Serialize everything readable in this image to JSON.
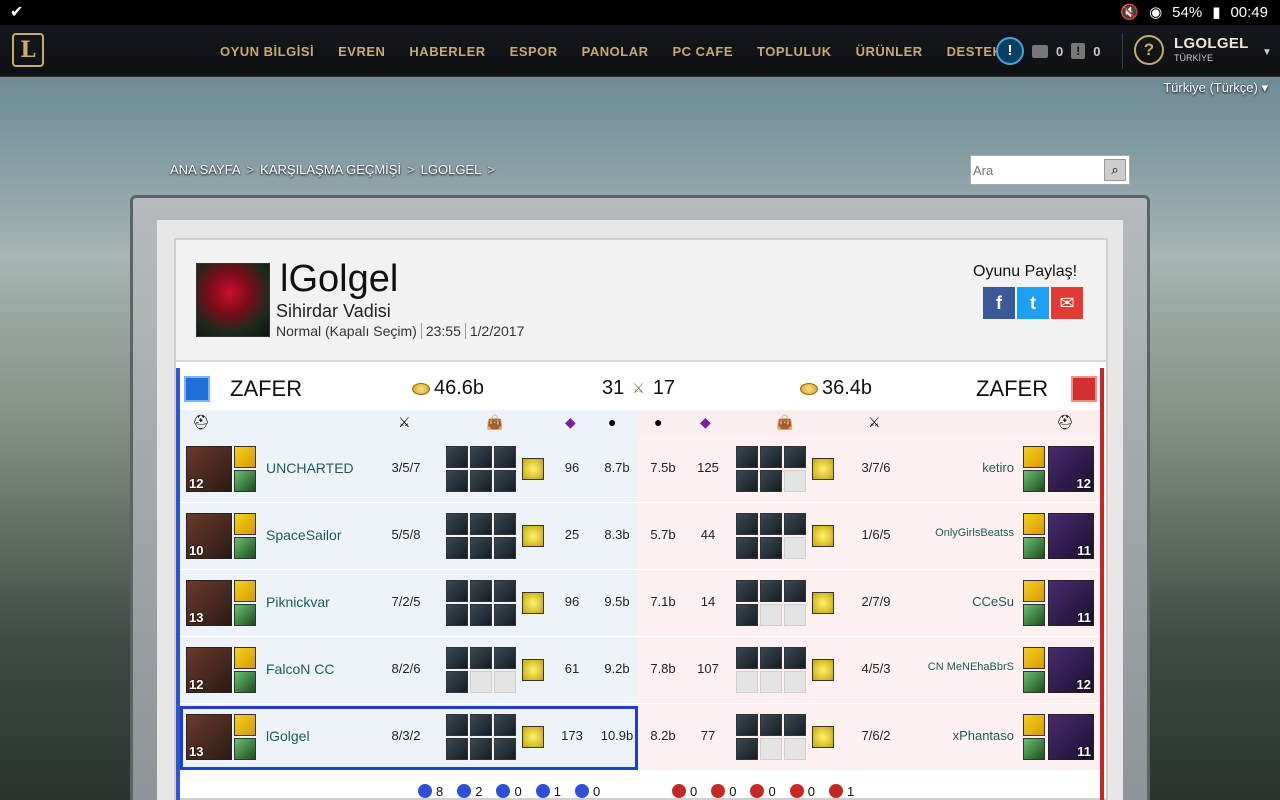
{
  "statusbar": {
    "battery": "54%",
    "time": "00:49"
  },
  "nav": {
    "links": [
      "OYUN BİLGİSİ",
      "EVREN",
      "HABERLER",
      "ESPOR",
      "PANOLAR",
      "PC CAFE",
      "TOPLULUK",
      "ÜRÜNLER",
      "DESTEK"
    ],
    "chat_count": "0",
    "alert_count": "0",
    "username": "LGOLGEL",
    "region": "TÜRKİYE"
  },
  "language": "Türkiye (Türkçe)",
  "breadcrumb": [
    "ANA SAYFA",
    "KARŞILAŞMA GEÇMİŞİ",
    "LGOLGEL"
  ],
  "search": {
    "placeholder": "Ara"
  },
  "game": {
    "summoner": "lGolgel",
    "map": "Sihirdar Vadisi",
    "mode": "Normal (Kapalı Seçim)",
    "duration": "23:55",
    "date": "1/2/2017",
    "share_label": "Oyunu Paylaş!"
  },
  "teams": {
    "blue": {
      "result": "ZAFER",
      "gold": "46.6b",
      "kills": "31"
    },
    "red": {
      "result": "ZAFER",
      "gold": "36.4b",
      "kills": "17"
    }
  },
  "rows": [
    {
      "blue": {
        "level": "12",
        "name": "UNCHARTED",
        "kda": "3/5/7",
        "cs": "96",
        "gold": "8.7b",
        "empty_items": 0
      },
      "red": {
        "level": "12",
        "name": "ketiro",
        "kda": "3/7/6",
        "cs": "125",
        "gold": "7.5b",
        "empty_items": 1
      }
    },
    {
      "blue": {
        "level": "10",
        "name": "SpaceSailor",
        "kda": "5/5/8",
        "cs": "25",
        "gold": "8.3b",
        "empty_items": 0
      },
      "red": {
        "level": "11",
        "name": "OnlyGirlsBeatss",
        "kda": "1/6/5",
        "cs": "44",
        "gold": "5.7b",
        "empty_items": 1
      }
    },
    {
      "blue": {
        "level": "13",
        "name": "Piknickvar",
        "kda": "7/2/5",
        "cs": "96",
        "gold": "9.5b",
        "empty_items": 0
      },
      "red": {
        "level": "11",
        "name": "CCeSu",
        "kda": "2/7/9",
        "cs": "14",
        "gold": "7.1b",
        "empty_items": 2
      }
    },
    {
      "blue": {
        "level": "12",
        "name": "FalcoN CC",
        "kda": "8/2/6",
        "cs": "61",
        "gold": "9.2b",
        "empty_items": 2
      },
      "red": {
        "level": "12",
        "name": "CN MeNEhaBbrS",
        "kda": "4/5/3",
        "cs": "107",
        "gold": "7.8b",
        "empty_items": 3
      }
    },
    {
      "blue": {
        "level": "13",
        "name": "lGolgel",
        "kda": "8/3/2",
        "cs": "173",
        "gold": "10.9b",
        "empty_items": 0
      },
      "red": {
        "level": "11",
        "name": "xPhantaso",
        "kda": "7/6/2",
        "cs": "77",
        "gold": "8.2b",
        "empty_items": 2
      }
    }
  ],
  "objectives": {
    "blue": [
      "8",
      "2",
      "0",
      "1",
      "0"
    ],
    "red": [
      "0",
      "0",
      "0",
      "0",
      "1"
    ]
  },
  "colors": {
    "accent_gold": "#c8aa6e",
    "blue_team": "#2f55d4",
    "red_team": "#c62828",
    "highlight": "#1f3fd1"
  }
}
